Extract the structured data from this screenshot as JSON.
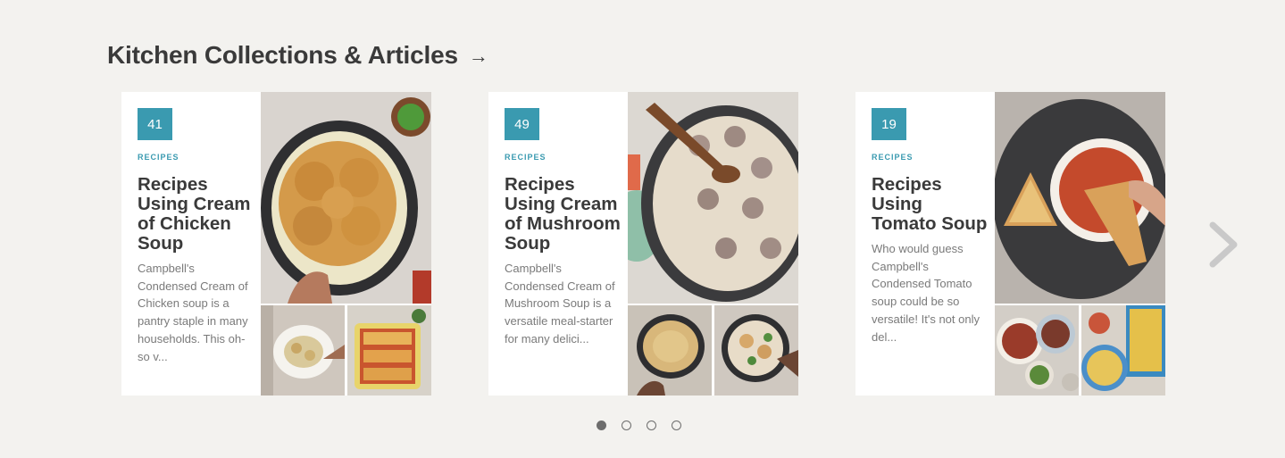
{
  "section": {
    "title": "Kitchen Collections & Articles",
    "arrow": "→"
  },
  "cards": [
    {
      "count": "41",
      "kicker": "RECIPES",
      "title": "Recipes Using Cream of Chicken Soup",
      "description": "Campbell's Condensed Cream of Chicken soup is a pantry staple in many households. This oh-so v..."
    },
    {
      "count": "49",
      "kicker": "RECIPES",
      "title": "Recipes Using Cream of Mushroom Soup",
      "description": "Campbell's Condensed Cream of Mushroom Soup is a versatile meal-starter for many delici..."
    },
    {
      "count": "19",
      "kicker": "RECIPES",
      "title": "Recipes Using Tomato Soup",
      "description": "Who would guess Campbell's Condensed Tomato soup could be so versatile! It's not only del..."
    }
  ],
  "carousel": {
    "next_icon": "chevron-right-icon",
    "page_count": 4,
    "active_page": 1
  },
  "colors": {
    "accent": "#3a9ab0",
    "background": "#f3f2ef",
    "title_text": "#3a3a3a",
    "body_text": "#7a7a7a"
  }
}
